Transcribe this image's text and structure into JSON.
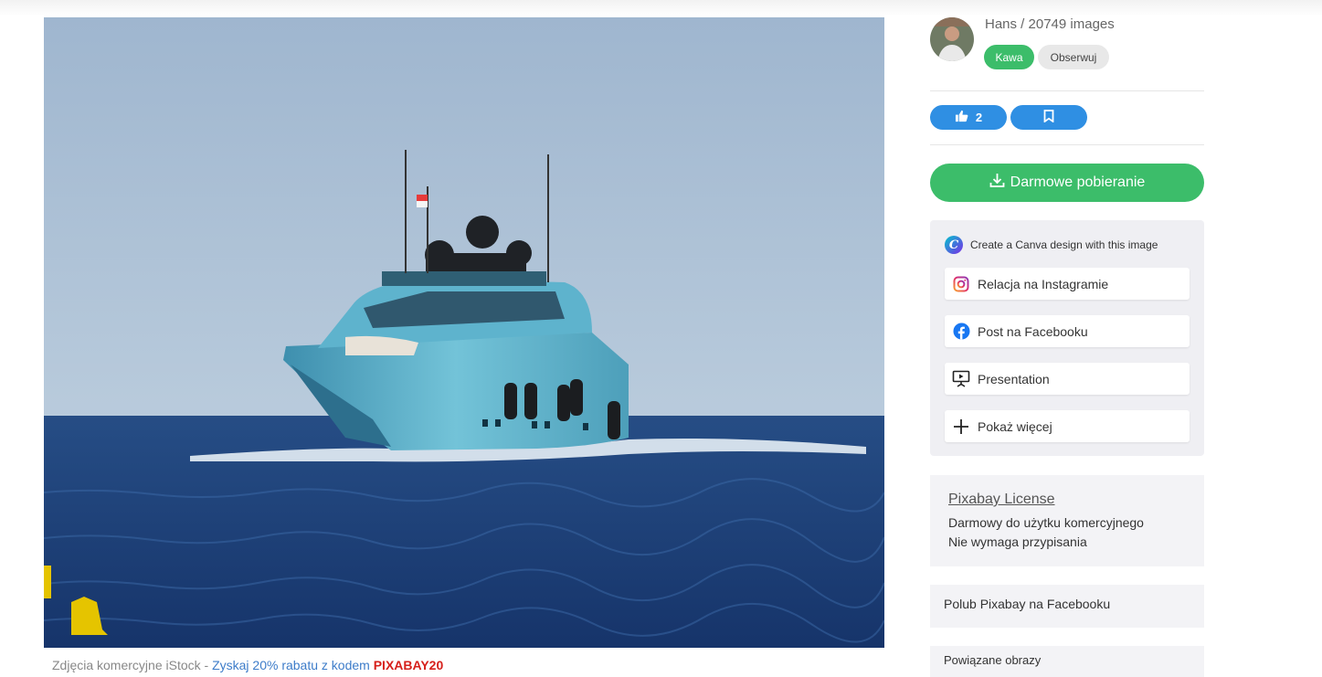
{
  "photo": {
    "icon": "yacht-photo"
  },
  "caption": {
    "prefix": "Zdjęcia komercyjne iStock",
    "separator": " - ",
    "promo": "Zyskaj 20% rabatu z kodem ",
    "code": "PIXABAY20"
  },
  "user": {
    "name_line": "Hans / 20749 images"
  },
  "buttons": {
    "coffee": "Kawa",
    "follow": "Obserwuj",
    "likes": "2",
    "download": "Darmowe pobieranie"
  },
  "share": {
    "canva": "Create a Canva design with this image",
    "items": [
      {
        "label": "Relacja na Instagramie",
        "icon": "instagram-icon"
      },
      {
        "label": "Post na Facebooku",
        "icon": "facebook-icon"
      },
      {
        "label": "Presentation",
        "icon": "presentation-icon"
      },
      {
        "label": "Pokaż więcej",
        "icon": "plus-icon"
      }
    ]
  },
  "license": {
    "title": "Pixabay License",
    "line1": "Darmowy do użytku komercyjnego",
    "line2": "Nie wymaga przypisania"
  },
  "facebook_like": "Polub Pixabay na Facebooku",
  "related": "Powiązane obrazy",
  "colors": {
    "green": "#3cbd6a",
    "blue": "#2f8fe3",
    "promo": "#3d7cc9",
    "code": "#d6201b"
  }
}
